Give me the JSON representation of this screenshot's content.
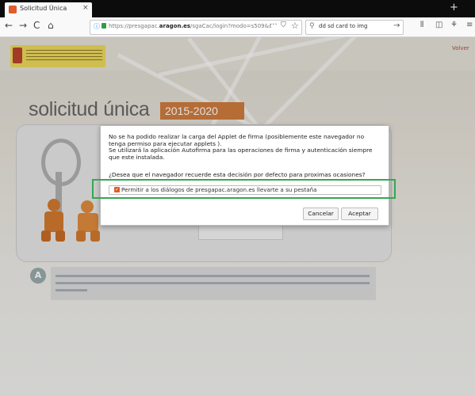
{
  "browser": {
    "tab_title": "Solicitud Única",
    "tab_close": "×",
    "new_tab": "+",
    "back": "←",
    "forward": "→",
    "reload": "C",
    "home": "⌂",
    "url_host": "aragon.es",
    "url_prefix": "https://presgapac.",
    "url_suffix": "/sgaCac/login?modo=s509&servi",
    "url_full": "https://presgapac.aragon.es/sgaCac/login?modo=s509&servi",
    "url_dots": "···",
    "search_text": "dd sd card to img",
    "search_go": "→",
    "toolbar_icons": [
      "library-icon",
      "sidebar-icon",
      "extension-icon",
      "menu-icon"
    ]
  },
  "page": {
    "header_link": "Volver",
    "app_title": "solicitud única",
    "app_years": "2015-2020",
    "info_letter": "A"
  },
  "dialog": {
    "message": "No se ha podido realizar la carga del Applet de firma (posiblemente este navegador no tenga permiso para ejecutar applets ).\nSe utilizará la aplicación Autofirma para las operaciones de firma y autenticación siempre que este instalada.",
    "question": "¿Desea que el navegador recuerde esta decisión por defecto para proximas ocasiones?",
    "checkbox_label": "Permitir a los diálogos de presgapac.aragon.es llevarte a su pestaña",
    "checkbox_checked": true,
    "cancel_label": "Cancelar",
    "accept_label": "Aceptar"
  },
  "colors": {
    "highlight": "#33a852",
    "brand_orange": "#d07c3d",
    "favicon": "#e15b2b"
  }
}
